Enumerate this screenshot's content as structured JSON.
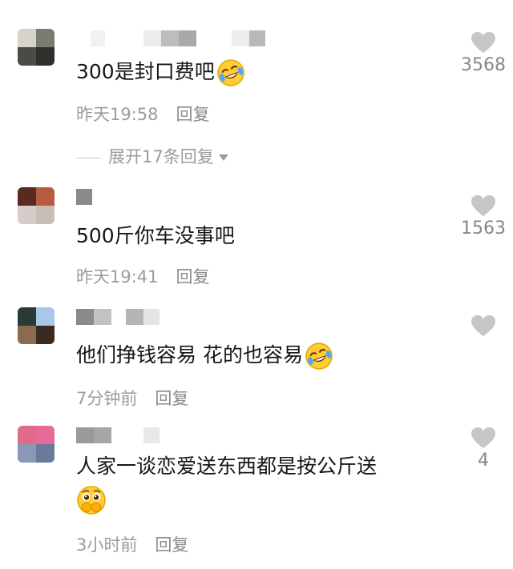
{
  "comments": [
    {
      "text": "300是封口费吧",
      "emoji": "rofl-emoji",
      "time": "昨天19:58",
      "reply": "回复",
      "likes": "3568",
      "expand": "展开17条回复"
    },
    {
      "text": "500斤你车没事吧",
      "time": "昨天19:41",
      "reply": "回复",
      "likes": "1563"
    },
    {
      "text": "他们挣钱容易 花的也容易",
      "emoji": "rofl-emoji",
      "time": "7分钟前",
      "reply": "回复",
      "likes": ""
    },
    {
      "text": "人家一谈恋爱送东西都是按公斤送",
      "emoji": "pleading-hands-emoji",
      "time": "3小时前",
      "reply": "回复",
      "likes": "4"
    }
  ],
  "colors": {
    "heart": "#c6c6c6",
    "meta": "#9c9c9c",
    "text": "#161616"
  }
}
